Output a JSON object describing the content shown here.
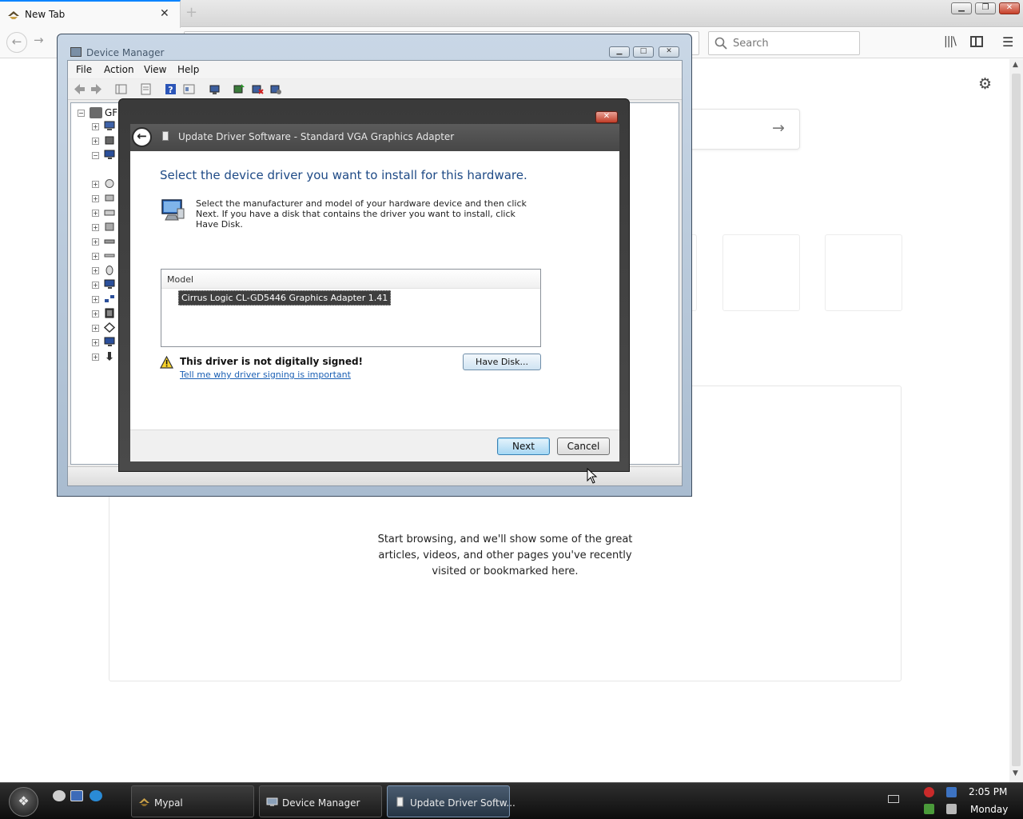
{
  "browser": {
    "tab_title": "New Tab",
    "tab_close": "✕",
    "new_tab": "+",
    "window_controls": {
      "minimize": "▁",
      "maximize": "❐",
      "close": "✕"
    },
    "back": "←",
    "forward": "→",
    "search_placeholder": "Search",
    "library": "|||\\",
    "menu": "☰"
  },
  "newtab": {
    "settings": "⚙",
    "search_go": "→",
    "highlights_empty_text": "Start browsing, and we'll show some of the great articles, videos, and other pages you've recently visited or bookmarked here."
  },
  "device_manager": {
    "title": "Device Manager",
    "controls": {
      "minimize": "▁",
      "maximize": "□",
      "close": "✕"
    },
    "menus": [
      "File",
      "Action",
      "View",
      "Help"
    ],
    "tree_root_label": "GFD",
    "tree_root_toggle": "−",
    "tree_toggle_expand": "+",
    "tree_toggle_collapse": "−"
  },
  "update_dialog": {
    "close": "✕",
    "back": "←",
    "title": "Update Driver Software - Standard VGA Graphics Adapter",
    "heading": "Select the device driver you want to install for this hardware.",
    "description": "Select the manufacturer and model of your hardware device and then click Next. If you have a disk that contains the driver you want to install, click Have Disk.",
    "model_column": "Model",
    "model_selected": "Cirrus Logic CL-GD5446 Graphics Adapter 1.41",
    "warning": "This driver is not digitally signed!",
    "signing_link": "Tell me why driver signing is important",
    "have_disk": "Have Disk...",
    "next": "Next",
    "cancel": "Cancel"
  },
  "taskbar": {
    "start": "❖",
    "tasks": [
      {
        "label": "Mypal"
      },
      {
        "label": "Device Manager"
      },
      {
        "label": "Update Driver Softw..."
      }
    ],
    "clock_time": "2:05 PM",
    "clock_day": "Monday"
  },
  "colors": {
    "accent_tab": "#0a84ff",
    "dialog_heading": "#1e4a86",
    "link": "#1a5fb4",
    "selection": "#3f3f3f"
  }
}
